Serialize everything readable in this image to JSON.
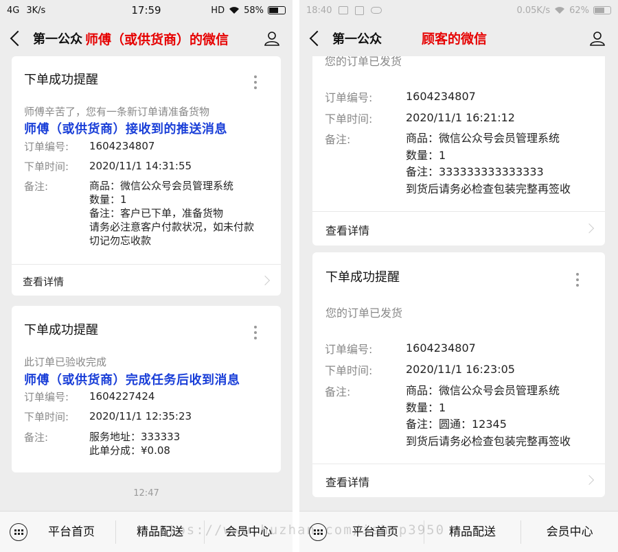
{
  "left": {
    "status": {
      "signal": "4G",
      "speed": "3K/s",
      "time": "17:59",
      "hd": "HD",
      "battery": "58%"
    },
    "nav": {
      "title": "第一公众",
      "tag": "师傅（或供货商）的微信"
    },
    "cards": [
      {
        "title": "下单成功提醒",
        "sub": "师傅辛苦了，您有一条新订单请准备货物",
        "annotation": "师傅（或供货商）接收到的推送消息",
        "order_no_label": "订单编号:",
        "order_no": "1604234807",
        "time_label": "下单时间:",
        "time": "2020/11/1 14:31:55",
        "note_label": "备注:",
        "note_lines": [
          "商品：微信公众号会员管理系统",
          "数量：1",
          "备注：客户已下单，准备货物",
          "请务必注意客户付款状况，如未付款",
          "切记勿忘收款"
        ],
        "detail": "查看详情"
      },
      {
        "title": "下单成功提醒",
        "sub": "此订单已验收完成",
        "annotation": "师傅（或供货商）完成任务后收到消息",
        "order_no_label": "订单编号:",
        "order_no": "1604227424",
        "time_label": "下单时间:",
        "time": "2020/11/1 12:35:23",
        "note_label": "备注:",
        "note_lines": [
          "服务地址：333333",
          "此单分成：¥0.08"
        ]
      }
    ],
    "timestamp": "12:47",
    "menu": [
      "平台首页",
      "精品配送",
      "会员中心"
    ]
  },
  "right": {
    "status": {
      "time": "18:40",
      "speed": "0.05K/s",
      "battery": "62%"
    },
    "nav": {
      "title": "第一公众",
      "tag": "顾客的微信"
    },
    "cards": [
      {
        "sub": "您的订单已发货",
        "order_no_label": "订单编号:",
        "order_no": "1604234807",
        "time_label": "下单时间:",
        "time": "2020/11/1 16:21:12",
        "note_label": "备注:",
        "note_lines": [
          "商品：微信公众号会员管理系统",
          "数量：1",
          "备注：333333333333333",
          "到货后请务必检查包装完整再签收"
        ],
        "detail": "查看详情"
      },
      {
        "title": "下单成功提醒",
        "sub": "您的订单已发货",
        "order_no_label": "订单编号:",
        "order_no": "1604234807",
        "time_label": "下单时间:",
        "time": "2020/11/1 16:23:05",
        "note_label": "备注:",
        "note_lines": [
          "商品：微信公众号会员管理系统",
          "数量：1",
          "备注：圆通：12345",
          "到货后请务必检查包装完整再签收"
        ],
        "detail": "查看详情"
      }
    ],
    "menu": [
      "平台首页",
      "精品配送",
      "会员中心"
    ]
  },
  "watermark": "https://www.huzhan.com/ishop3950"
}
